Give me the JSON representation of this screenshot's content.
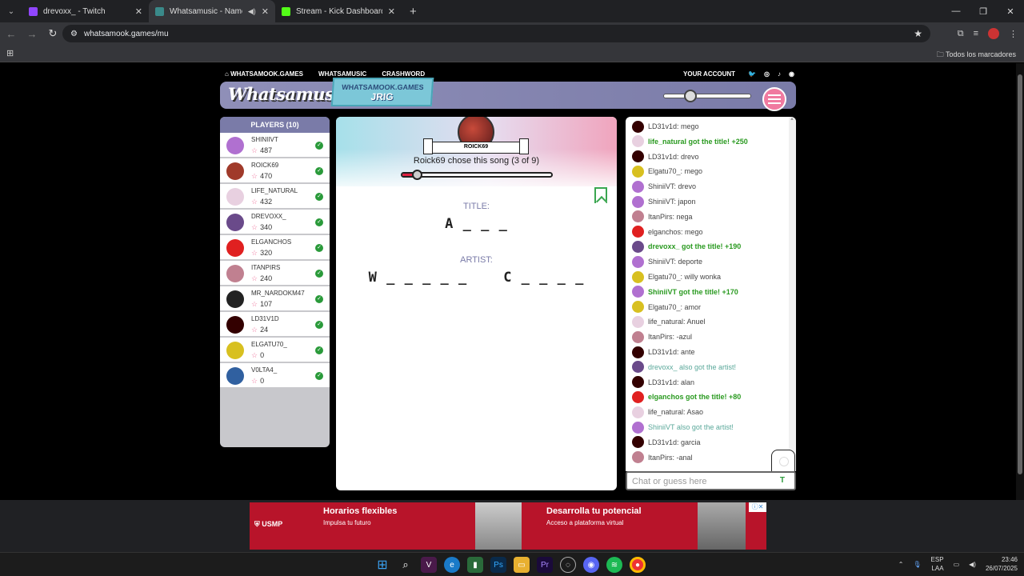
{
  "browser": {
    "tabs": [
      {
        "title": "drevoxx_ - Twitch",
        "color": "#9146ff"
      },
      {
        "title": "Whatsamusic - Name That",
        "color": "#3a8a8a"
      },
      {
        "title": "Stream - Kick Dashboard",
        "color": "#53fc18"
      }
    ],
    "url": "whatsamook.games/mu",
    "all_bookmarks": "Todos los marcadores"
  },
  "nav": {
    "home": "WHATSAMOOK.GAMES",
    "music": "WHATSAMUSIC",
    "crashword": "CRASHWORD",
    "account": "YOUR ACCOUNT"
  },
  "header": {
    "logo": "Whatsamusic",
    "badge_top": "WHATSAMOOK.GAMES",
    "badge_bottom": "JRIG",
    "volume_level": 0.3
  },
  "players": {
    "title": "PLAYERS (10)",
    "list": [
      {
        "name": "SHINIIVT",
        "score": "487",
        "color": "#b070d0"
      },
      {
        "name": "ROICK69",
        "score": "470",
        "color": "#a03a2a"
      },
      {
        "name": "LIFE_NATURAL",
        "score": "432",
        "color": "#e8d0e0"
      },
      {
        "name": "DREVOXX_",
        "score": "340",
        "color": "#6a4a8a"
      },
      {
        "name": "ELGANCHOS",
        "score": "320",
        "color": "#e02020"
      },
      {
        "name": "ITANPIRS",
        "score": "240",
        "color": "#c08090"
      },
      {
        "name": "MR_NARDOKM47",
        "score": "107",
        "color": "#222"
      },
      {
        "name": "LD31V1D",
        "score": "24",
        "color": "#300"
      },
      {
        "name": "ELGATU70_",
        "score": "0",
        "color": "#d8c020"
      },
      {
        "name": "V0LTA4_",
        "score": "0",
        "color": "#3060a0"
      }
    ]
  },
  "game": {
    "chooser": "ROICK69",
    "chose_text": "Roick69 chose this song (3 of 9)",
    "timer_progress": 0.1,
    "title_label": "TITLE:",
    "title_hint": "A _ _ _",
    "artist_label": "ARTIST:",
    "artist_hint": "W _ _ _ _ _    C _ _ _ _"
  },
  "chat": {
    "messages": [
      {
        "text": "LD31v1d: mego",
        "kind": "normal",
        "color": "#300"
      },
      {
        "text": "life_natural got the title! +250",
        "kind": "title",
        "color": "#e8d0e0"
      },
      {
        "text": "LD31v1d: drevo",
        "kind": "normal",
        "color": "#300"
      },
      {
        "text": "Elgatu70_: mego",
        "kind": "normal",
        "color": "#d8c020"
      },
      {
        "text": "ShiniiVT: drevo",
        "kind": "normal",
        "color": "#b070d0"
      },
      {
        "text": "ShiniiVT: japon",
        "kind": "normal",
        "color": "#b070d0"
      },
      {
        "text": "ItanPirs: nega",
        "kind": "normal",
        "color": "#c08090"
      },
      {
        "text": "elganchos: mego",
        "kind": "normal",
        "color": "#e02020"
      },
      {
        "text": "drevoxx_ got the title! +190",
        "kind": "title",
        "color": "#6a4a8a"
      },
      {
        "text": "ShiniiVT: deporte",
        "kind": "normal",
        "color": "#b070d0"
      },
      {
        "text": "Elgatu70_: willy wonka",
        "kind": "normal",
        "color": "#d8c020"
      },
      {
        "text": "ShiniiVT got the title! +170",
        "kind": "title",
        "color": "#b070d0"
      },
      {
        "text": "Elgatu70_: amor",
        "kind": "normal",
        "color": "#d8c020"
      },
      {
        "text": "life_natural: Anuel",
        "kind": "normal",
        "color": "#e8d0e0"
      },
      {
        "text": "ItanPirs: -azul",
        "kind": "normal",
        "color": "#c08090"
      },
      {
        "text": "LD31v1d: ante",
        "kind": "normal",
        "color": "#300"
      },
      {
        "text": "drevoxx_ also got the artist!",
        "kind": "artist",
        "color": "#6a4a8a"
      },
      {
        "text": "LD31v1d: alan",
        "kind": "normal",
        "color": "#300"
      },
      {
        "text": "elganchos got the title! +80",
        "kind": "title",
        "color": "#e02020"
      },
      {
        "text": "life_natural: Asao",
        "kind": "normal",
        "color": "#e8d0e0"
      },
      {
        "text": "ShiniiVT also got the artist!",
        "kind": "artist",
        "color": "#b070d0"
      },
      {
        "text": "LD31v1d: garcia",
        "kind": "normal",
        "color": "#300"
      },
      {
        "text": "ItanPirs: -anal",
        "kind": "normal",
        "color": "#c08090"
      }
    ],
    "placeholder": "Chat or guess here",
    "send_label": "T"
  },
  "ad": {
    "brand": "USMP",
    "h1": "Horarios flexibles",
    "s1": "Impulsa tu futuro",
    "h2": "Desarrolla tu potencial",
    "s2": "Acceso a plataforma virtual"
  },
  "taskbar": {
    "lang1": "ESP",
    "lang2": "LAA",
    "time": "23:46",
    "date": "26/07/2025"
  }
}
